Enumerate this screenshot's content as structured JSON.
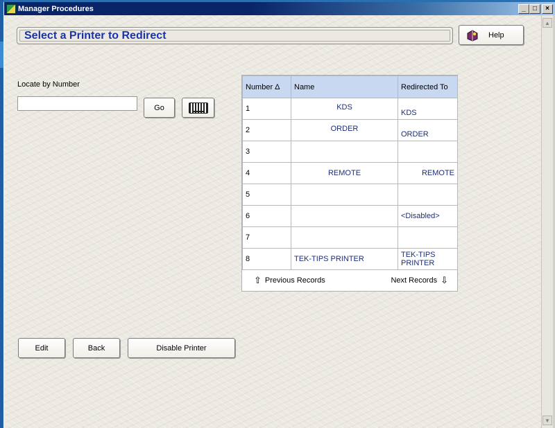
{
  "window": {
    "title": "Manager Procedures",
    "minimize_label": "_",
    "maximize_label": "□",
    "close_label": "×"
  },
  "header": {
    "title": "Select a Printer to Redirect",
    "help_label": "Help"
  },
  "locate": {
    "label": "Locate by Number",
    "value": "",
    "go_label": "Go"
  },
  "grid": {
    "columns": [
      "Number Δ",
      "Name",
      "Redirected To"
    ],
    "rows": [
      {
        "number": "1",
        "name": "KDS",
        "redirected": "KDS"
      },
      {
        "number": "2",
        "name": "ORDER",
        "redirected": "ORDER"
      },
      {
        "number": "3",
        "name": "",
        "redirected": ""
      },
      {
        "number": "4",
        "name": "REMOTE",
        "redirected": "REMOTE"
      },
      {
        "number": "5",
        "name": "",
        "redirected": ""
      },
      {
        "number": "6",
        "name": "",
        "redirected": "<Disabled>"
      },
      {
        "number": "7",
        "name": "",
        "redirected": ""
      },
      {
        "number": "8",
        "name": "TEK-TIPS PRINTER",
        "redirected": "TEK-TIPS PRINTER"
      }
    ],
    "previous_label": "Previous Records",
    "next_label": "Next Records"
  },
  "actions": {
    "edit_label": "Edit",
    "back_label": "Back",
    "disable_label": "Disable Printer"
  },
  "colors": {
    "title_text": "#1a34a8",
    "grid_header": "#c8d8f0",
    "cell_text": "#1a2d7a"
  }
}
